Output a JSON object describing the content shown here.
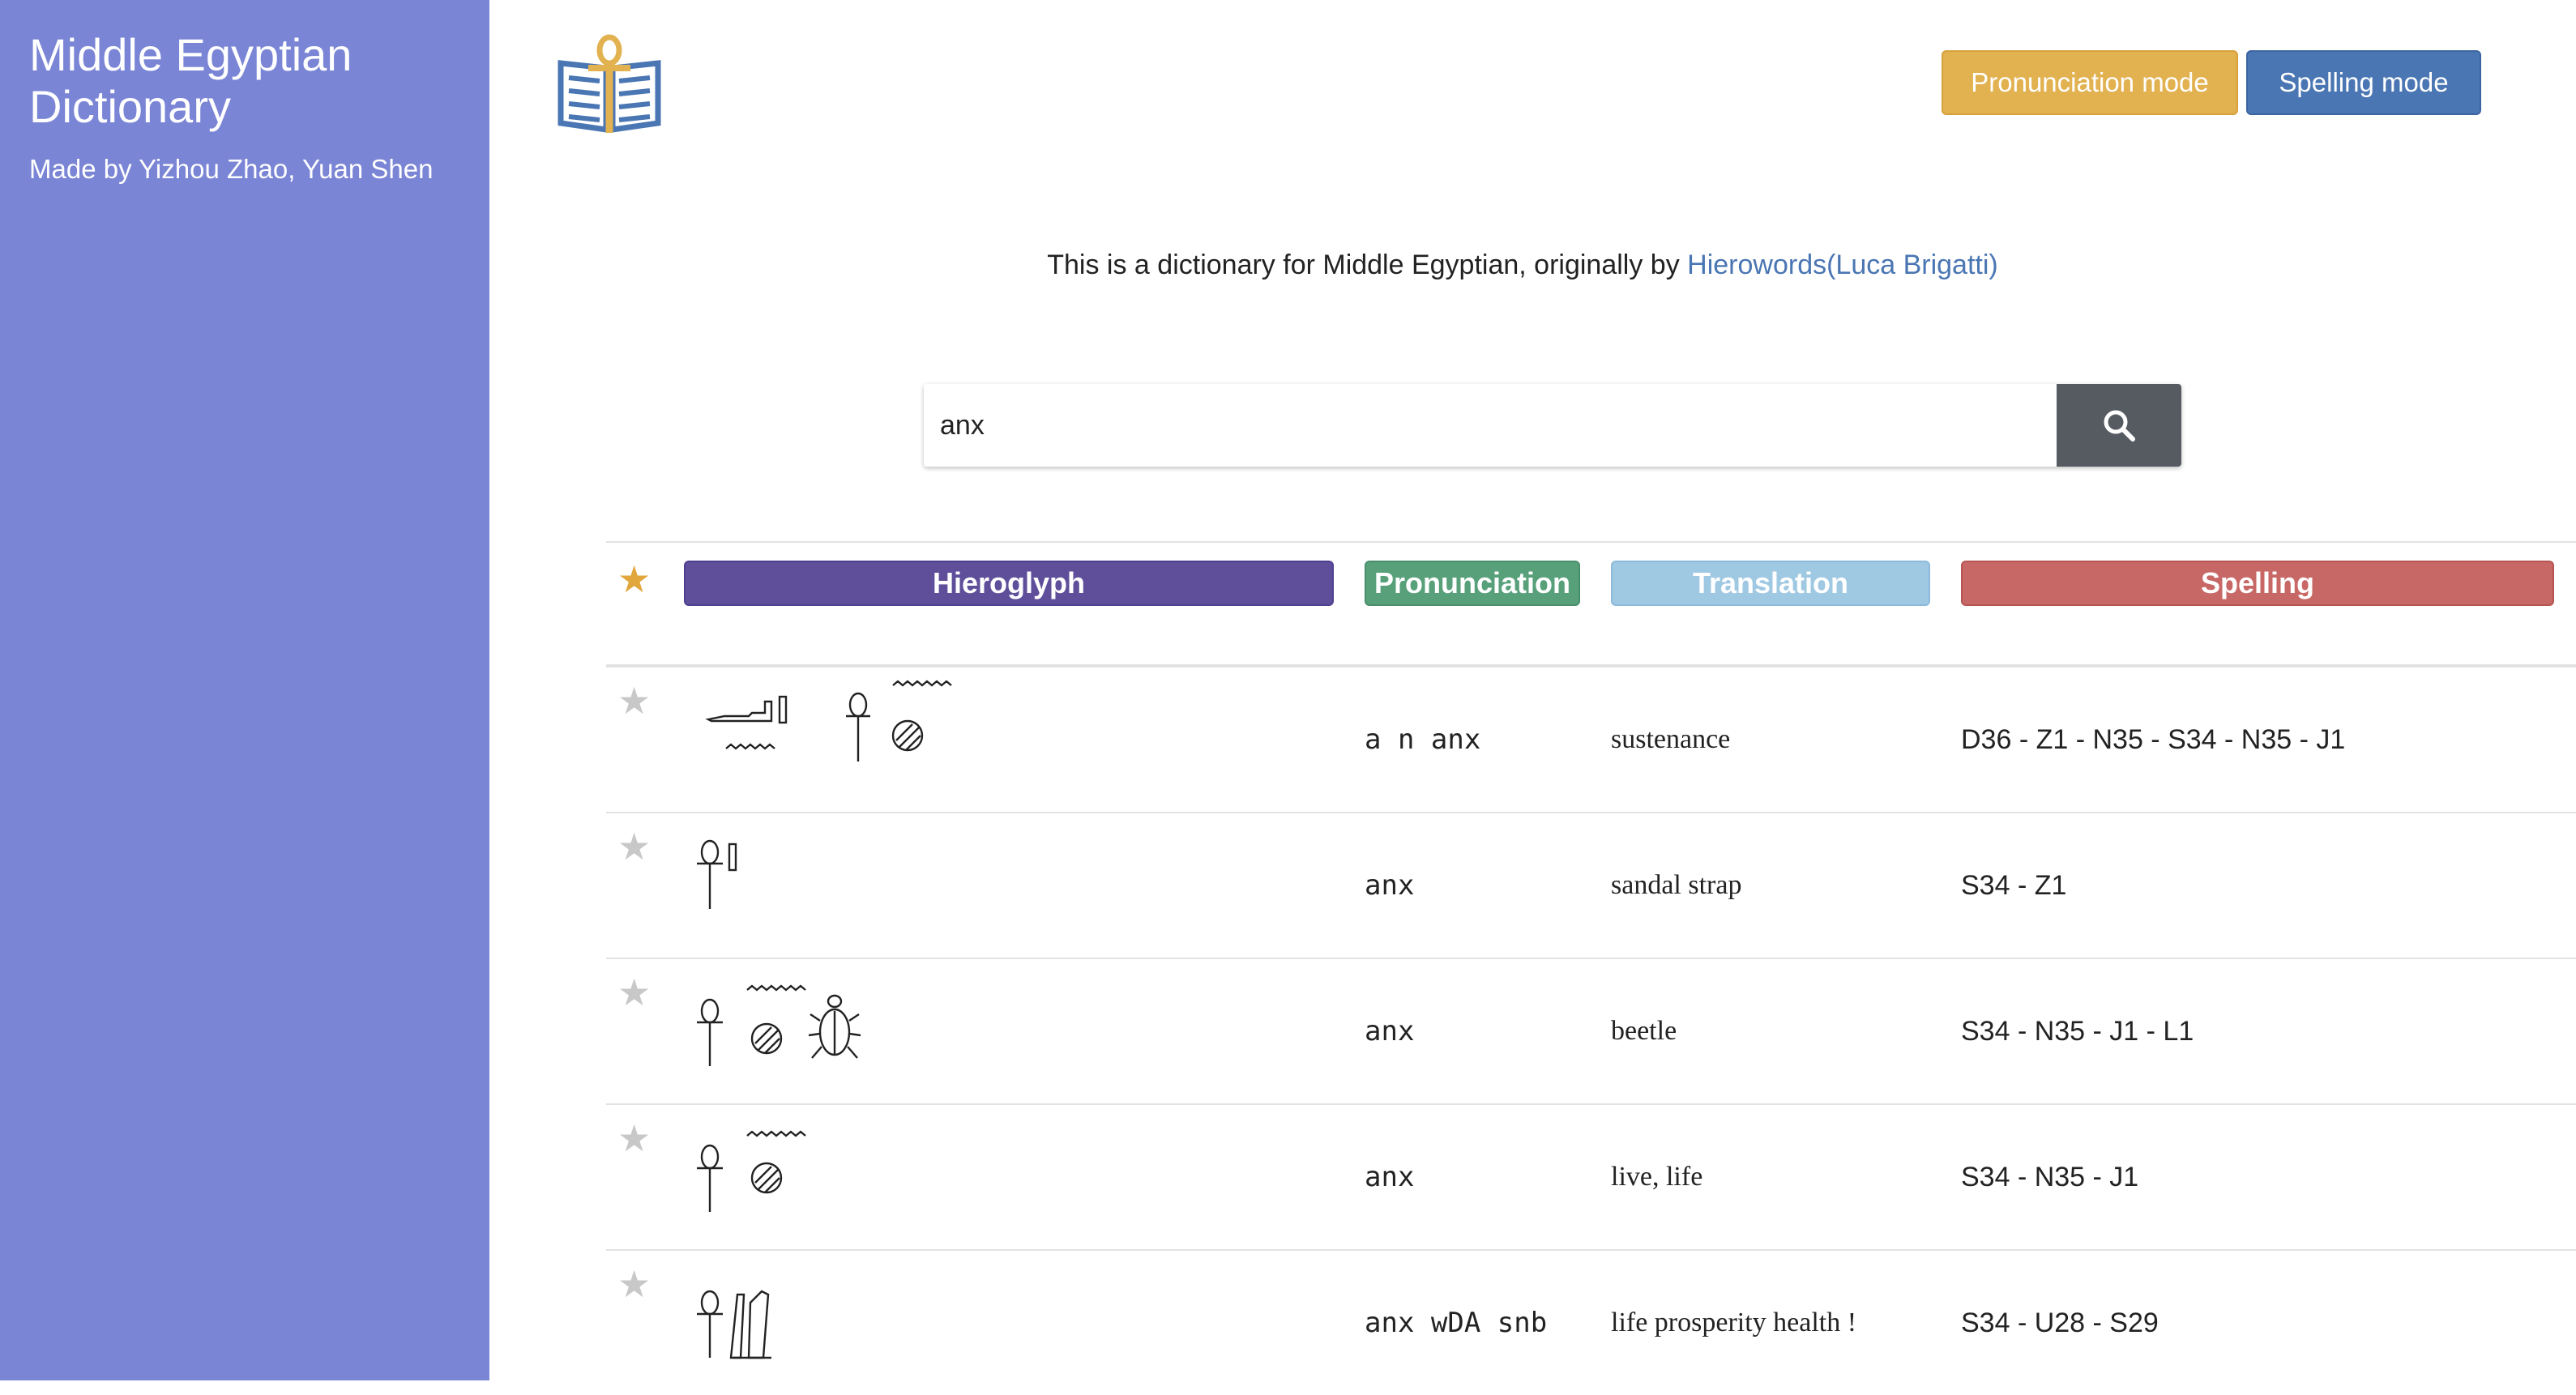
{
  "sidebar": {
    "title": "Middle Egyptian Dictionary",
    "credits": "Made by Yizhou Zhao, Yuan Shen"
  },
  "header": {
    "logo_icon": "book-ankh-icon",
    "pronunciation_mode_label": "Pronunciation mode",
    "spelling_mode_label": "Spelling mode"
  },
  "intro": {
    "text": "This is a dictionary for Middle Egyptian, originally by ",
    "link_text": "Hierowords(Luca Brigatti)"
  },
  "search": {
    "value": "anx",
    "button_icon": "search-icon"
  },
  "table": {
    "favorite_header_icon": "star-icon",
    "columns": [
      "Hieroglyph",
      "Pronunciation",
      "Translation",
      "Spelling"
    ],
    "rows": [
      {
        "pronunciation": "a n anx",
        "translation": "sustenance",
        "spelling": "D36 - Z1 - N35 - S34 - N35 - J1"
      },
      {
        "pronunciation": "anx",
        "translation": "sandal strap",
        "spelling": "S34 - Z1"
      },
      {
        "pronunciation": "anx",
        "translation": "beetle",
        "spelling": "S34 - N35 - J1 - L1"
      },
      {
        "pronunciation": "anx",
        "translation": "live, life",
        "spelling": "S34 - N35 - J1"
      },
      {
        "pronunciation": "anx wDA snb",
        "translation": "life prosperity health !",
        "spelling": "S34 - U28 - S29"
      }
    ]
  },
  "colors": {
    "sidebar": "#7a85d5",
    "pronunciation_mode": "#e2b150",
    "spelling_mode": "#4a76b3",
    "hieroglyph_header": "#5f4f9b",
    "pronunciation_header": "#57a07a",
    "translation_header": "#9fc8e2",
    "spelling_header": "#c86866",
    "favorite_star": "#e2a73c",
    "inactive_star": "#c8c8c8"
  }
}
